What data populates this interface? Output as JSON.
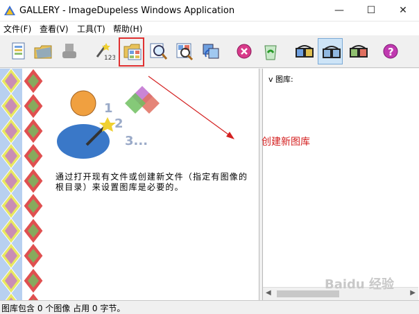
{
  "window": {
    "title": "GALLERY - ImageDupeless Windows Application",
    "minimize": "—",
    "maximize": "☐",
    "close": "✕"
  },
  "menu": [
    {
      "label": "文件(F)"
    },
    {
      "label": "查看(V)"
    },
    {
      "label": "工具(T)"
    },
    {
      "label": "帮助(H)"
    }
  ],
  "toolbar": {
    "buttons": [
      {
        "icon": "new-document-icon"
      },
      {
        "icon": "open-folder-icon"
      },
      {
        "icon": "disabled-hand-icon"
      },
      {
        "icon": "wizard-123-icon"
      },
      {
        "icon": "create-gallery-icon",
        "highlighted": true
      },
      {
        "icon": "magnifier-icon"
      },
      {
        "icon": "search-grid-icon"
      },
      {
        "icon": "refresh-swap-icon"
      },
      {
        "icon": "stop-icon"
      },
      {
        "icon": "recycle-bin-icon"
      },
      {
        "icon": "viewer-glasses-icon"
      },
      {
        "icon": "viewer-glasses-pressed-icon",
        "pressed": true
      },
      {
        "icon": "viewer-glasses-alt-icon"
      },
      {
        "icon": "help-icon"
      }
    ]
  },
  "main": {
    "description": "通过打开现有文件或创建新文件（指定有图像的根目录）来设置图库是必要的。",
    "illustration_numbers": [
      "1",
      "2",
      "3..."
    ]
  },
  "right_panel": {
    "label": "v 图库:"
  },
  "annotation": {
    "text": "创建新图库"
  },
  "status": {
    "text": "图库包含 0 个图像 占用 0 字节。"
  },
  "watermark": {
    "text": "Baidu 经验"
  },
  "colors": {
    "annotation": "#d42020",
    "pressed_bg": "#cde4f7"
  }
}
